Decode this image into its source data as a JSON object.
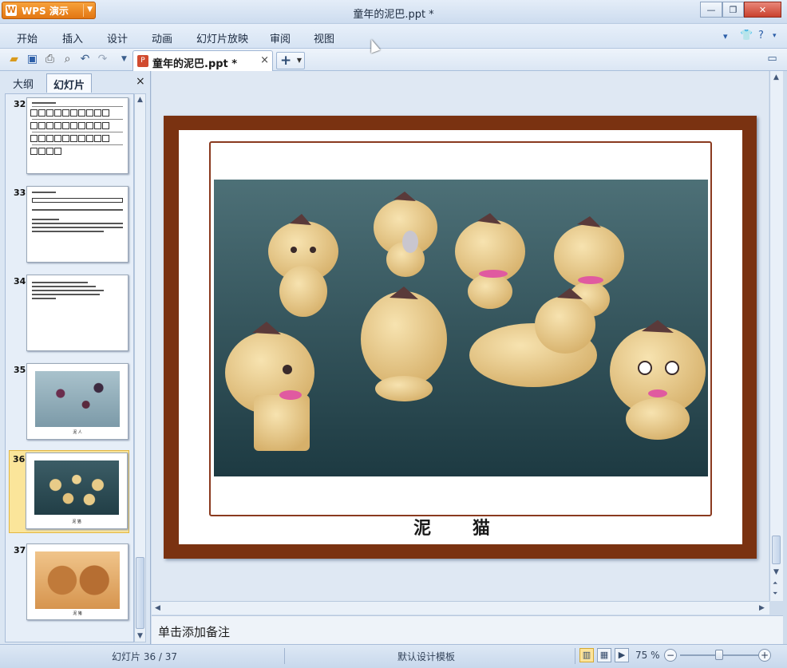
{
  "app": {
    "logo_label": "WPS 演示",
    "window_title": "童年的泥巴.ppt *"
  },
  "window_controls": {
    "minimize": "—",
    "restore": "❐",
    "close": "✕"
  },
  "menu": {
    "items": [
      "开始",
      "插入",
      "设计",
      "动画",
      "幻灯片放映",
      "审阅",
      "视图"
    ]
  },
  "toolbar": {
    "icons": [
      "open-folder-icon",
      "save-icon",
      "print-icon",
      "print-preview-icon",
      "undo-icon",
      "redo-icon",
      "customize-dropdown-icon"
    ]
  },
  "document_tab": {
    "name": "童年的泥巴.ppt *",
    "close": "×",
    "new_tab": "+"
  },
  "left_pane": {
    "tabs": [
      "大纲",
      "幻灯片"
    ],
    "active_tab": "幻灯片",
    "close": "×",
    "slides": [
      {
        "number": "32",
        "kind": "pinyin"
      },
      {
        "number": "33",
        "kind": "text"
      },
      {
        "number": "34",
        "kind": "text"
      },
      {
        "number": "35",
        "kind": "photo",
        "caption": "泥 人"
      },
      {
        "number": "36",
        "kind": "photo",
        "caption": "泥 猫",
        "selected": true
      },
      {
        "number": "37",
        "kind": "photo",
        "caption": "泥 猪"
      }
    ]
  },
  "slide": {
    "caption": "泥 猫"
  },
  "notes": {
    "placeholder": "单击添加备注"
  },
  "statusbar": {
    "slide_counter": "幻灯片 36 / 37",
    "template": "默认设计模板",
    "zoom": "75 %",
    "zoom_level": 0.5
  },
  "colors": {
    "accent_orange": "#e27612",
    "frame_brown": "#7a3211",
    "selection_yellow": "#fbe59a"
  }
}
